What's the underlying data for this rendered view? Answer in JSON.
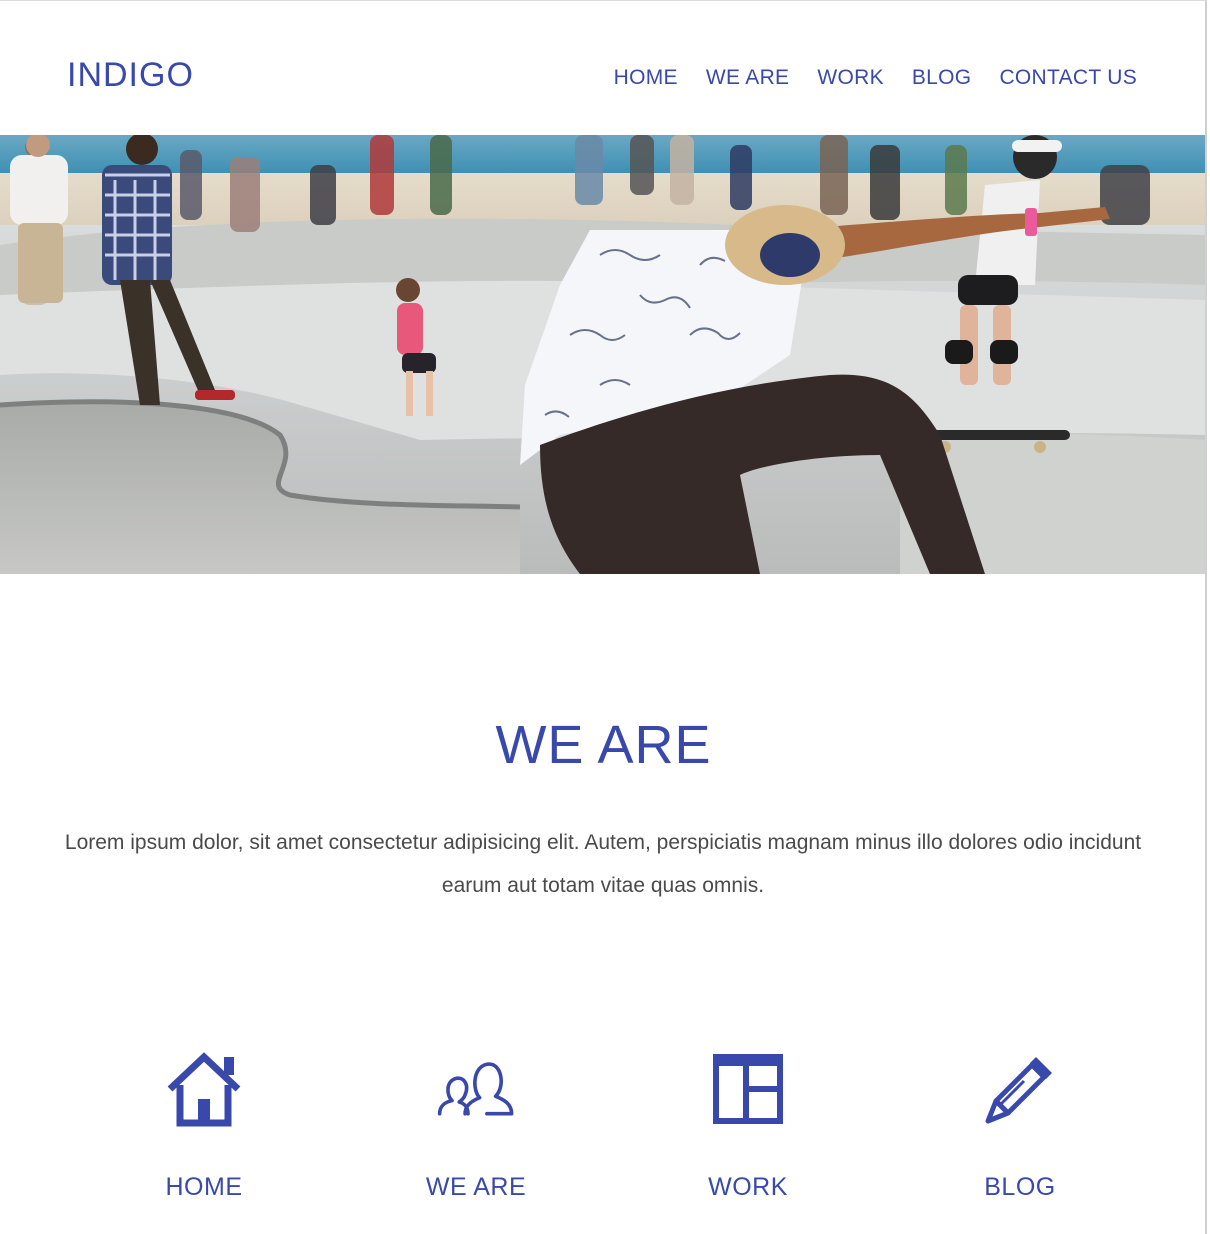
{
  "site": {
    "logo": "INDIGO",
    "brand_color": "#3949ab"
  },
  "nav": {
    "items": [
      {
        "label": "HOME"
      },
      {
        "label": "WE ARE"
      },
      {
        "label": "WORK"
      },
      {
        "label": "BLOG"
      },
      {
        "label": "CONTACT US"
      }
    ]
  },
  "hero": {
    "image": "skatepark-photo"
  },
  "about": {
    "title": "WE ARE",
    "text": "Lorem ipsum dolor, sit amet consectetur adipisicing elit. Autem, perspiciatis magnam minus illo dolores odio incidunt earum aut totam vitae quas omnis."
  },
  "features": [
    {
      "label": "HOME",
      "icon": "home-icon"
    },
    {
      "label": "WE ARE",
      "icon": "users-icon"
    },
    {
      "label": "WORK",
      "icon": "layout-icon"
    },
    {
      "label": "BLOG",
      "icon": "pencil-icon"
    }
  ]
}
